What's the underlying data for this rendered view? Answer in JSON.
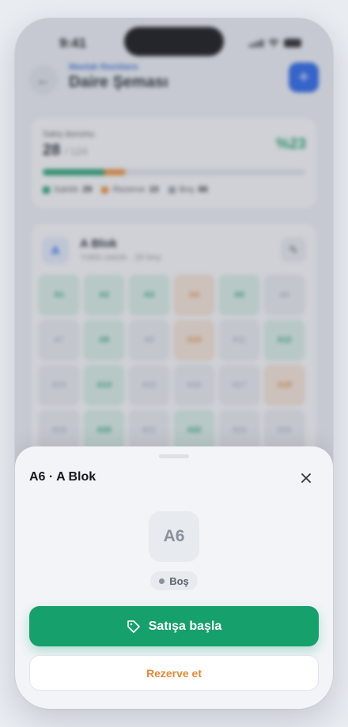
{
  "status_bar": {
    "time": "9:41"
  },
  "header": {
    "breadcrumb": "Maslak Rezidans",
    "title": "Daire Şeması"
  },
  "sales": {
    "label": "Satış durumu",
    "sold_count": "28",
    "total": "/ 124",
    "percent": "%23",
    "progress": {
      "sold": 29,
      "reserved": 10,
      "empty": 86,
      "total": 124
    },
    "legend": [
      {
        "label": "Satıldı",
        "count": "29",
        "color": "#1ea06b"
      },
      {
        "label": "Rezerve",
        "count": "10",
        "color": "#f0903a"
      },
      {
        "label": "Boş",
        "count": "86",
        "color": "#9aa1ab"
      }
    ]
  },
  "block": {
    "badge": "A",
    "name": "A Blok",
    "subtitle": "Yüklü satılık · 26 boş",
    "units": [
      {
        "code": "A1",
        "status": "sold"
      },
      {
        "code": "A2",
        "status": "sold"
      },
      {
        "code": "A3",
        "status": "sold"
      },
      {
        "code": "A4",
        "status": "res"
      },
      {
        "code": "A5",
        "status": "sold"
      },
      {
        "code": "A6",
        "status": "empty"
      },
      {
        "code": "A7",
        "status": "empty"
      },
      {
        "code": "A8",
        "status": "sold"
      },
      {
        "code": "A9",
        "status": "empty"
      },
      {
        "code": "A10",
        "status": "res"
      },
      {
        "code": "A11",
        "status": "empty"
      },
      {
        "code": "A12",
        "status": "sold"
      },
      {
        "code": "A13",
        "status": "empty"
      },
      {
        "code": "A14",
        "status": "sold"
      },
      {
        "code": "A15",
        "status": "empty"
      },
      {
        "code": "A16",
        "status": "empty"
      },
      {
        "code": "A17",
        "status": "empty"
      },
      {
        "code": "A18",
        "status": "res"
      },
      {
        "code": "A19",
        "status": "empty"
      },
      {
        "code": "A20",
        "status": "sold"
      },
      {
        "code": "A21",
        "status": "empty"
      },
      {
        "code": "A22",
        "status": "sold"
      },
      {
        "code": "A23",
        "status": "empty"
      },
      {
        "code": "A24",
        "status": "empty"
      }
    ]
  },
  "sheet": {
    "title": "A6 · A Blok",
    "close_icon": "close-icon",
    "unit_code": "A6",
    "status": "Boş",
    "primary_label": "Satışa başla",
    "primary_icon": "tag-icon",
    "secondary_label": "Rezerve et",
    "colors": {
      "primary": "#16a06c",
      "secondary_text": "#e48a38"
    }
  }
}
